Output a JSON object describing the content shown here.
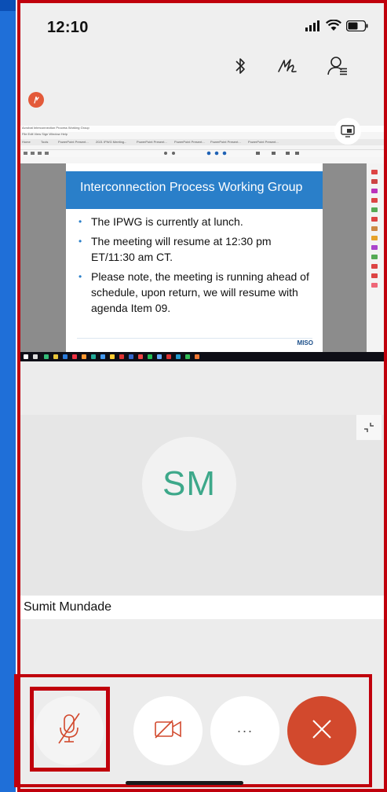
{
  "status_bar": {
    "time": "12:10",
    "icons": [
      "signal-icon",
      "wifi-icon",
      "battery-icon"
    ]
  },
  "toolbar": {
    "icons": [
      "bluetooth-icon",
      "annotate-icon",
      "participants-icon"
    ]
  },
  "recording": {
    "icon": "recording-icon",
    "color": "#e35a3a"
  },
  "shared_screen": {
    "window_title": "Acrobat Interconnection Process Working Group",
    "menu": "File  Edit  View  Sign  Window  Help",
    "tabs": [
      "Home",
      "Tools",
      "PowerPoint Present...",
      "2021 IPWG Meeting...",
      "PowerPoint Present...",
      "PowerPoint Present...",
      "PowerPoint Present...",
      "PowerPoint Present..."
    ],
    "slide": {
      "title": "Interconnection Process Working Group",
      "bullets": [
        "The IPWG is currently at lunch.",
        "The meeting will resume at 12:30 pm ET/11:30 am CT.",
        "Please note, the meeting is running ahead of schedule, upon return, we will resume with agenda Item 09."
      ],
      "logo": "MISO"
    },
    "share_toggle_icon": "screen-share-icon"
  },
  "participant": {
    "initials": "SM",
    "name": "Sumit Mundade",
    "minimize_icon": "minimize-icon"
  },
  "controls": {
    "mute": "microphone-muted-icon",
    "video": "video-off-icon",
    "more": "···",
    "leave": "close-icon"
  },
  "colors": {
    "accent_red": "#c0000c",
    "leave_button": "#d2492d",
    "avatar_text": "#3da88a",
    "slide_title_bg": "#2a7fc9"
  }
}
